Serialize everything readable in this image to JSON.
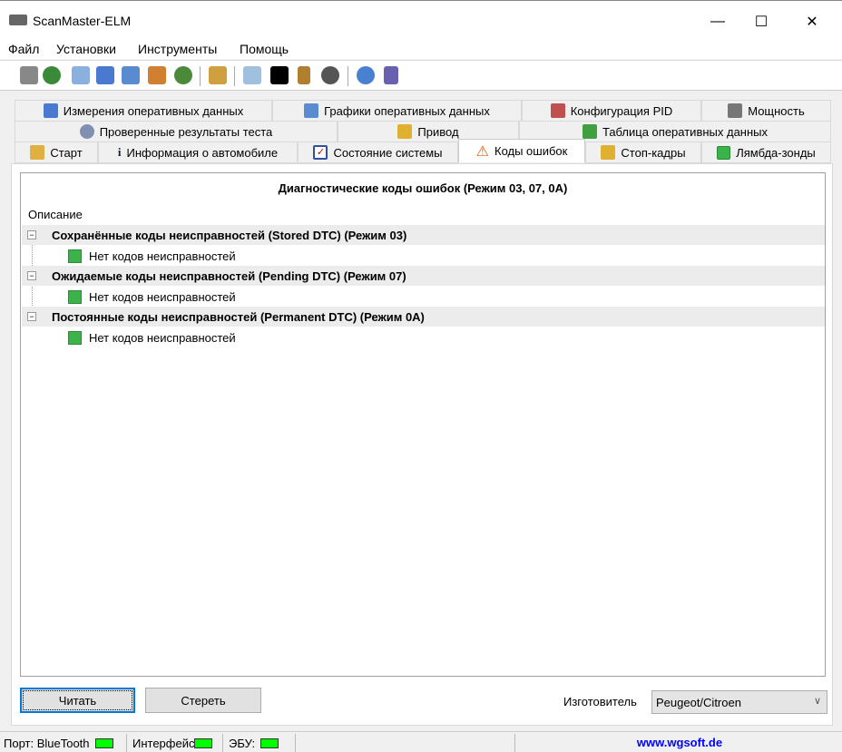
{
  "window": {
    "title": "ScanMaster-ELM",
    "minimize": "—",
    "maximize": "☐",
    "close": "✕"
  },
  "menu": [
    "Файл",
    "Установки",
    "Инструменты",
    "Помощь"
  ],
  "toolbar": [
    "connect-icon",
    "globe-icon",
    "report-icon",
    "grid-icon",
    "chart-icon",
    "windows-icon",
    "user-icon",
    "clipboard-icon",
    "search-window-icon",
    "terminal-icon",
    "device-icon",
    "gauge-icon",
    "info-icon",
    "exit-icon"
  ],
  "tabs": {
    "row1": [
      "Измерения оперативных данных",
      "Графики оперативных данных",
      "Конфигурация PID",
      "Мощность"
    ],
    "row2": [
      "Проверенные результаты теста",
      "Привод",
      "Таблица оперативных данных"
    ],
    "row3": [
      "Старт",
      "Информация о автомобиле",
      "Состояние системы",
      "Коды ошибок",
      "Стоп-кадры",
      "Лямбда-зонды"
    ]
  },
  "main": {
    "title": "Диагностические коды ошибок (Режим 03, 07, 0A)",
    "column": "Описание",
    "groups": [
      {
        "label": "Сохранённые коды неисправностей (Stored DTC) (Режим 03)",
        "item": "Нет кодов неисправностей"
      },
      {
        "label": "Ожидаемые коды неисправностей (Pending DTC) (Режим 07)",
        "item": "Нет кодов неисправностей"
      },
      {
        "label": "Постоянные коды неисправностей (Permanent DTC) (Режим 0A)",
        "item": "Нет кодов неисправностей"
      }
    ],
    "read": "Читать",
    "clear": "Стереть",
    "manufacturer_label": "Изготовитель",
    "manufacturer": "Peugeot/Citroen"
  },
  "status": {
    "port": "Порт: BlueTooth",
    "interface": "Интерфейс:",
    "ecu": "ЭБУ:",
    "link": "www.wgsoft.de"
  },
  "colors": {
    "led": "#00ff00",
    "link": "#0000ff",
    "selected_btn": "#0078d7"
  }
}
